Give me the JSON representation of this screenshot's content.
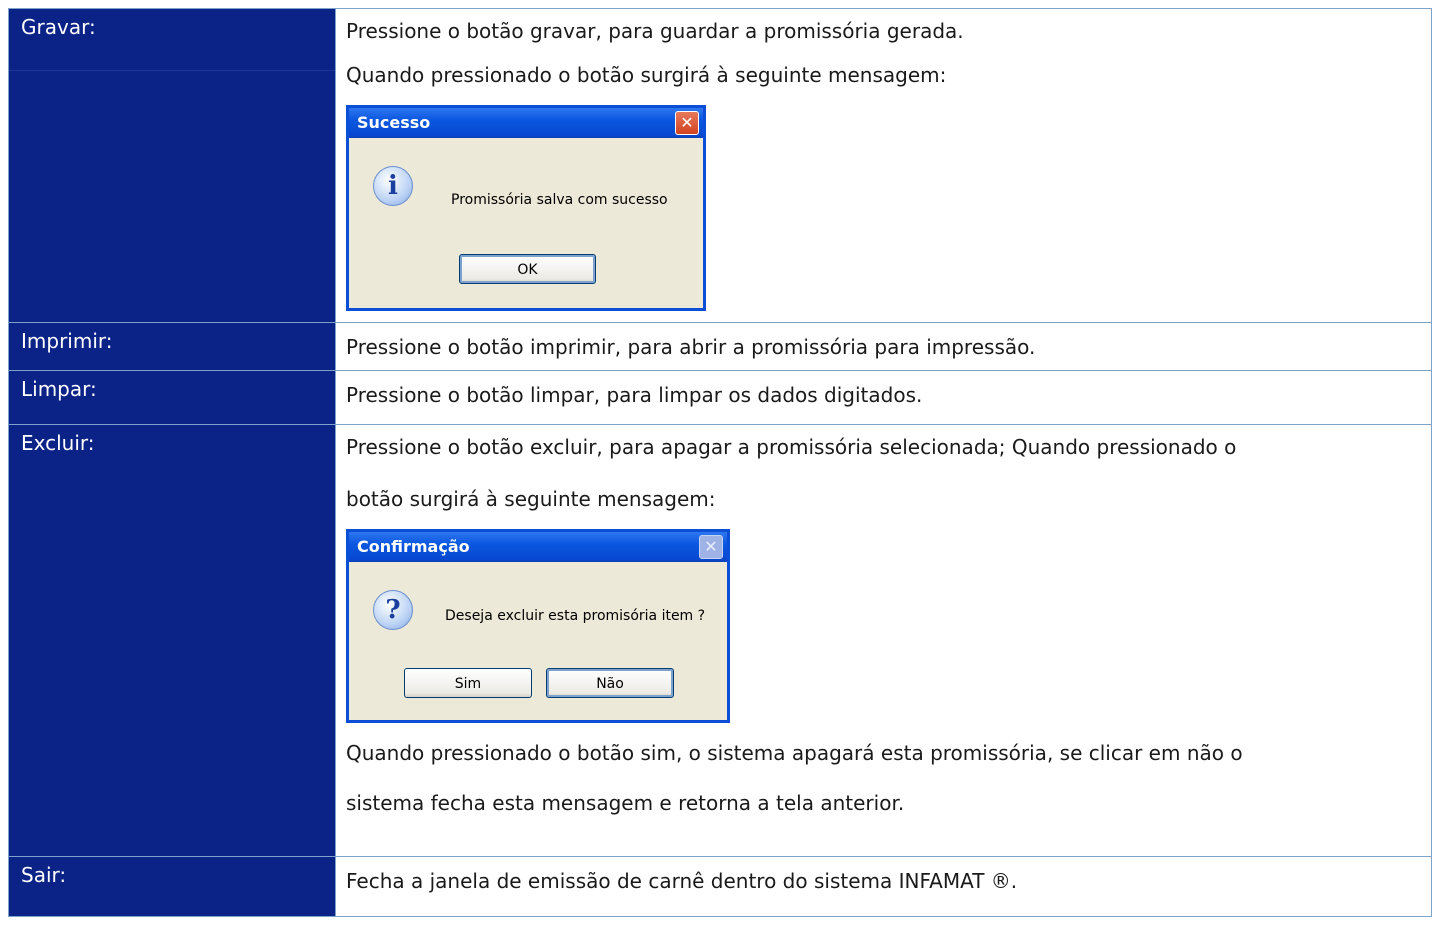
{
  "rows": [
    {
      "label": "Gravar:",
      "lines": [
        "Pressione o botão gravar, para guardar a promissória gerada.",
        "Quando pressionado o botão surgirá à seguinte mensagem:"
      ],
      "dialog": {
        "title": "Sucesso",
        "message": "Promissória salva com sucesso",
        "buttons": [
          "OK"
        ],
        "icon": "info-icon"
      }
    },
    {
      "label": "Imprimir:",
      "lines": [
        "Pressione o botão imprimir, para abrir a promissória para impressão."
      ]
    },
    {
      "label": "Limpar:",
      "lines": [
        "Pressione o botão limpar, para limpar os dados digitados."
      ]
    },
    {
      "label": "Excluir:",
      "lines": [
        "Pressione o botão excluir, para apagar a promissória selecionada; Quando pressionado o",
        "botão surgirá à seguinte mensagem:"
      ],
      "dialog": {
        "title": "Confirmação",
        "message": "Deseja excluir esta promisória item ?",
        "buttons": [
          "Sim",
          "Não"
        ],
        "icon": "question-icon"
      },
      "after_lines": [
        "Quando pressionado o botão sim, o sistema apagará esta promissória, se clicar em não o",
        "sistema fecha esta mensagem e retorna a tela anterior."
      ]
    },
    {
      "label": "Sair:",
      "lines": [
        "Fecha a janela de emissão de carnê dentro do sistema INFAMAT ®."
      ]
    }
  ],
  "colors": {
    "label_bg": "#0b2287",
    "label_text": "#ffffff",
    "border": "#7ea3c9"
  }
}
